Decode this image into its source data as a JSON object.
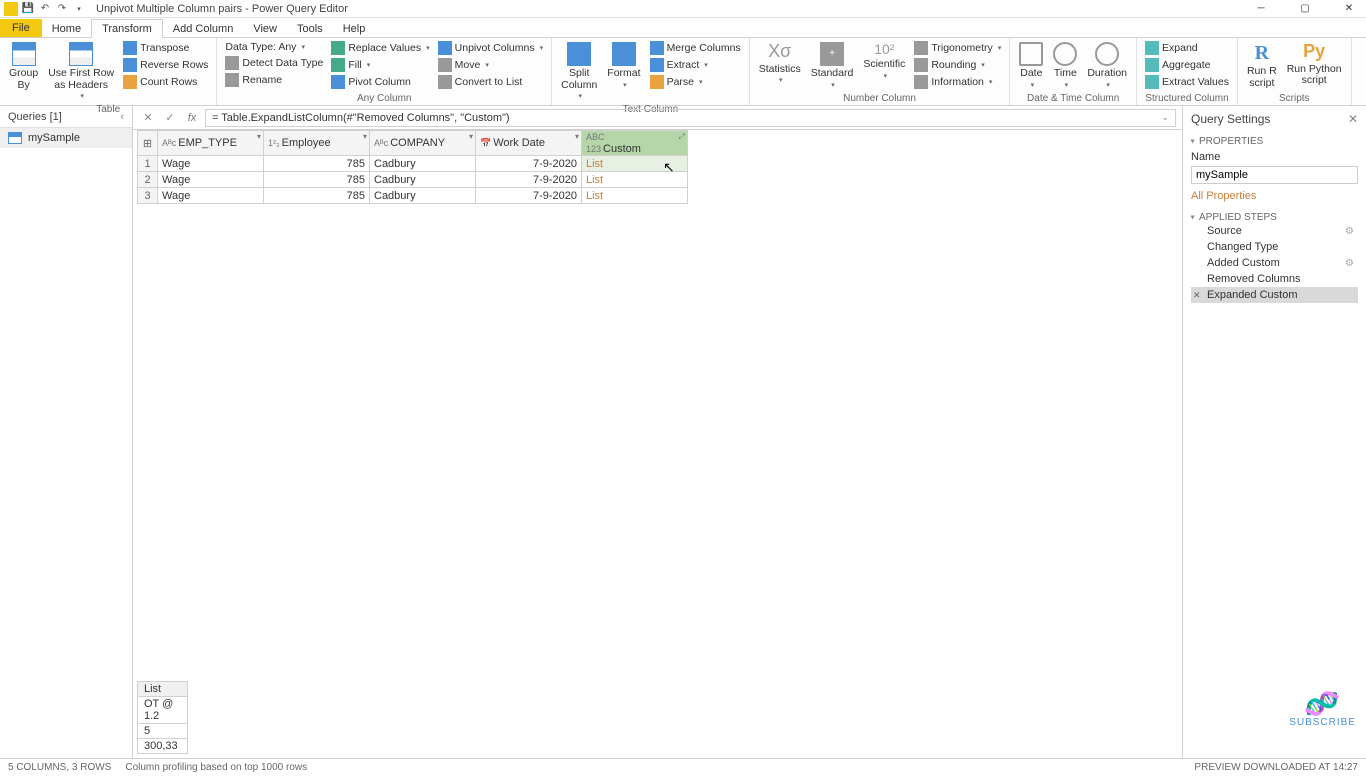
{
  "title": "Unpivot Multiple Column pairs - Power Query Editor",
  "menu": {
    "file": "File",
    "home": "Home",
    "transform": "Transform",
    "addcol": "Add Column",
    "view": "View",
    "tools": "Tools",
    "help": "Help"
  },
  "ribbon": {
    "groupBy": "Group\nBy",
    "useFirst": "Use First Row\nas Headers",
    "transpose": "Transpose",
    "reverse": "Reverse Rows",
    "countRows": "Count Rows",
    "tableGrp": "Table",
    "dataType": "Data Type: Any",
    "detect": "Detect Data Type",
    "rename": "Rename",
    "replace": "Replace Values",
    "fill": "Fill",
    "pivot": "Pivot Column",
    "unpivot": "Unpivot Columns",
    "move": "Move",
    "convert": "Convert to List",
    "anyColGrp": "Any Column",
    "split": "Split\nColumn",
    "format": "Format",
    "merge": "Merge Columns",
    "extractT": "Extract",
    "parse": "Parse",
    "textGrp": "Text Column",
    "stats": "Statistics",
    "standard": "Standard",
    "scientific": "Scientific",
    "trig": "Trigonometry",
    "round": "Rounding",
    "info": "Information",
    "numGrp": "Number Column",
    "date": "Date",
    "time": "Time",
    "duration": "Duration",
    "dtGrp": "Date & Time Column",
    "expand": "Expand",
    "aggregate": "Aggregate",
    "extractV": "Extract Values",
    "structGrp": "Structured Column",
    "runR": "Run R\nscript",
    "runPy": "Run Python\nscript",
    "scriptsGrp": "Scripts"
  },
  "queries": {
    "header": "Queries [1]",
    "item": "mySample"
  },
  "formula": "= Table.ExpandListColumn(#\"Removed Columns\", \"Custom\")",
  "columns": {
    "c1": "EMP_TYPE",
    "c2": "Employee",
    "c3": "COMPANY",
    "c4": "Work Date",
    "c5": "Custom"
  },
  "rows": [
    {
      "n": "1",
      "t": "Wage",
      "e": "785",
      "c": "Cadbury",
      "d": "7-9-2020",
      "cu": "List"
    },
    {
      "n": "2",
      "t": "Wage",
      "e": "785",
      "c": "Cadbury",
      "d": "7-9-2020",
      "cu": "List"
    },
    {
      "n": "3",
      "t": "Wage",
      "e": "785",
      "c": "Cadbury",
      "d": "7-9-2020",
      "cu": "List"
    }
  ],
  "preview": {
    "hdr": "List",
    "v1": "OT @ 1.2",
    "v2": "5",
    "v3": "300,33"
  },
  "settings": {
    "title": "Query Settings",
    "props": "PROPERTIES",
    "nameLbl": "Name",
    "name": "mySample",
    "allProps": "All Properties",
    "stepsLbl": "APPLIED STEPS",
    "steps": {
      "s1": "Source",
      "s2": "Changed Type",
      "s3": "Added Custom",
      "s4": "Removed Columns",
      "s5": "Expanded Custom"
    }
  },
  "subscribe": "SUBSCRIBE",
  "status": {
    "left": "5 COLUMNS, 3 ROWS",
    "mid": "Column profiling based on top 1000 rows",
    "right": "PREVIEW DOWNLOADED AT 14:27"
  }
}
